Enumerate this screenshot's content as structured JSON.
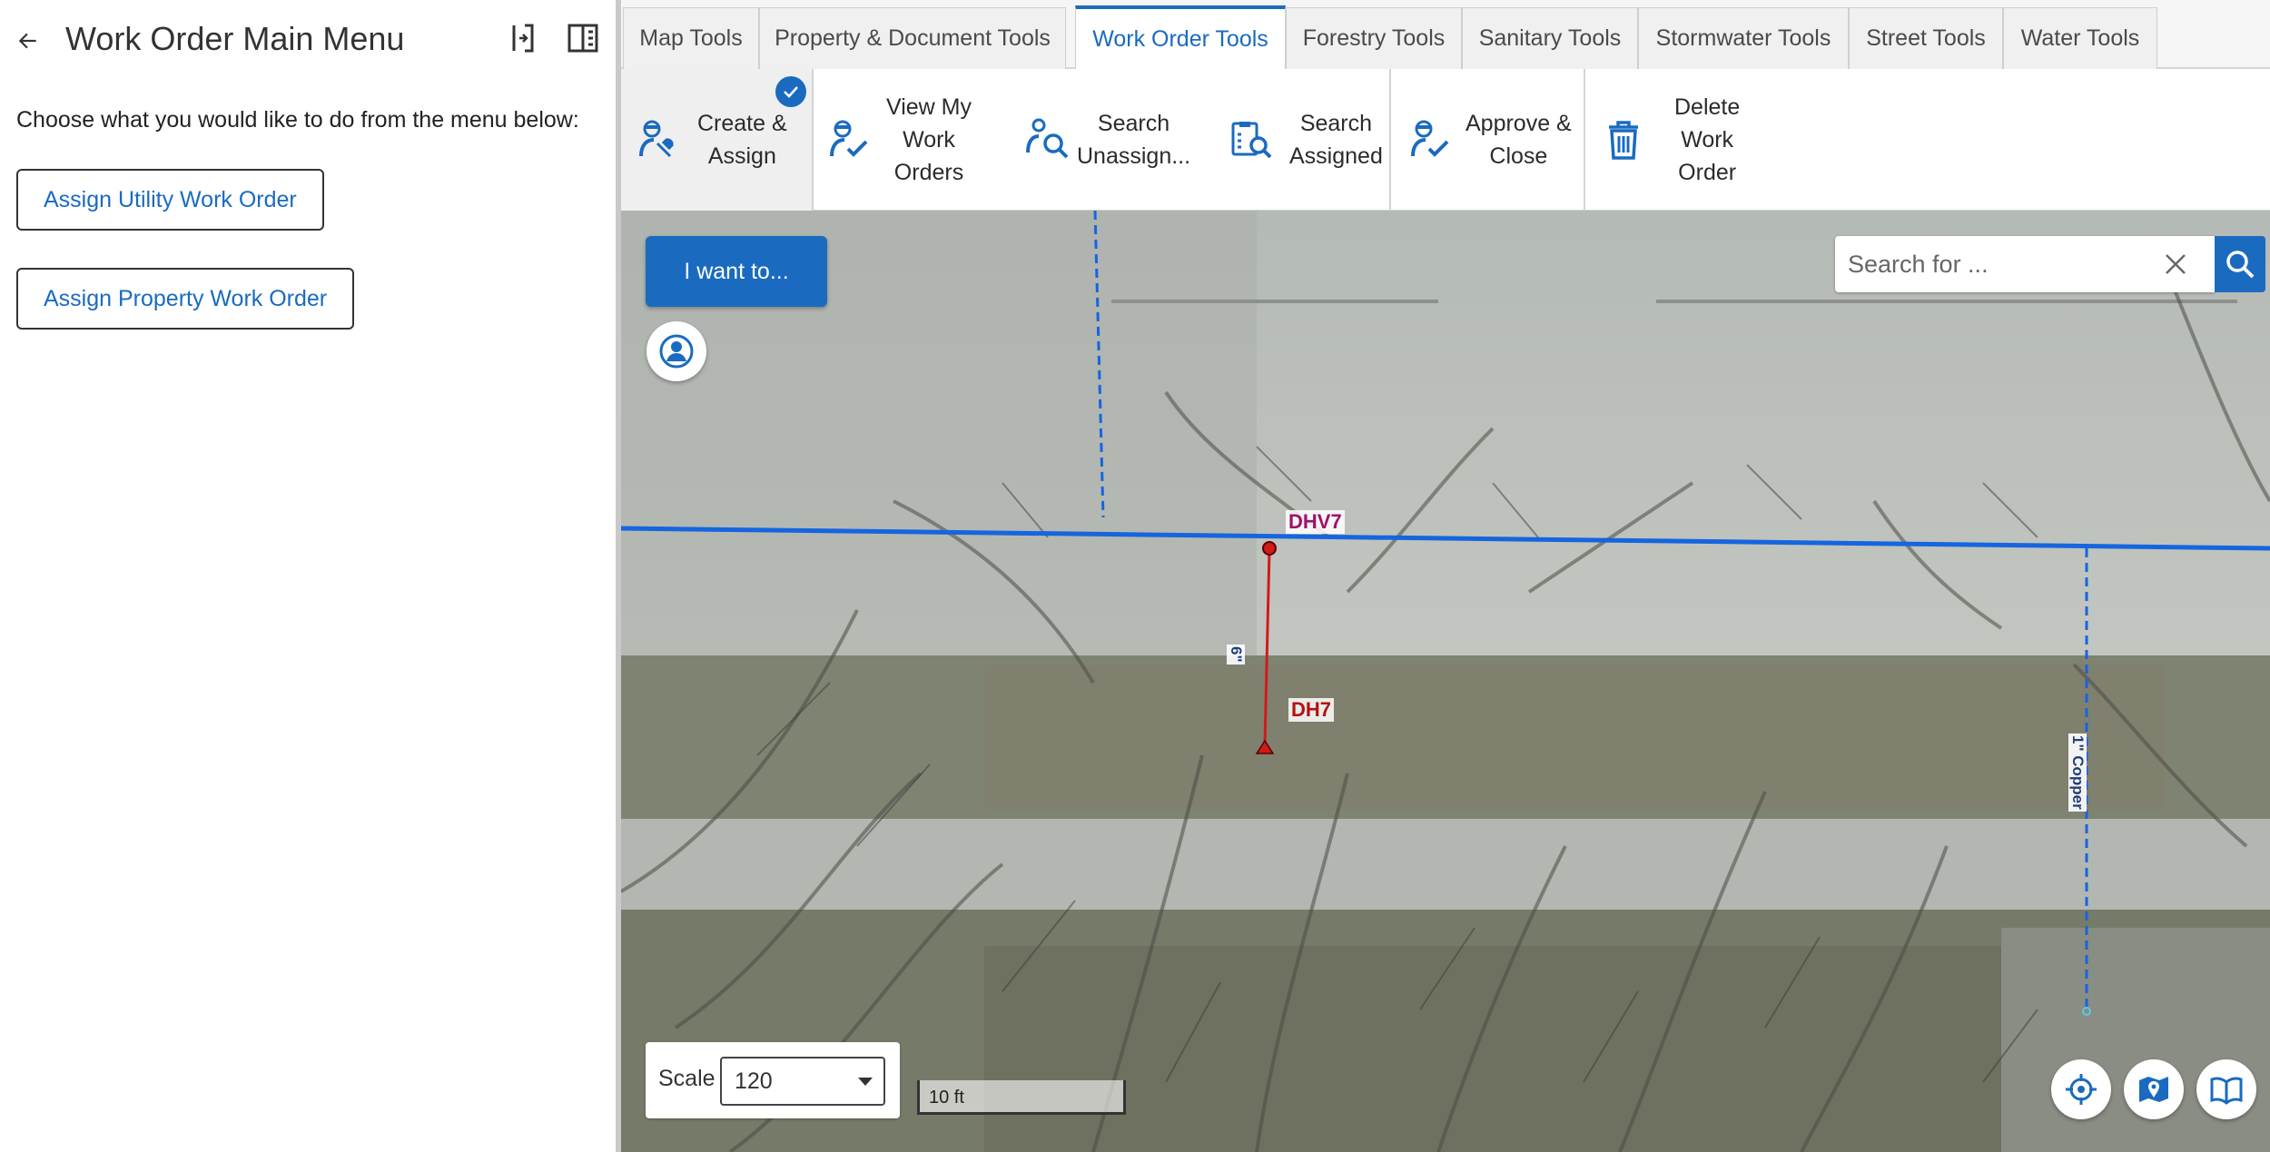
{
  "left_panel": {
    "title": "Work Order Main Menu",
    "instruction": "Choose what you would like to do from the menu below:",
    "buttons": [
      "Assign Utility Work Order",
      "Assign Property Work Order"
    ]
  },
  "tabs": [
    "Map Tools",
    "Property & Document Tools",
    "Work Order Tools",
    "Forestry Tools",
    "Sanitary Tools",
    "Stormwater Tools",
    "Street Tools",
    "Water Tools"
  ],
  "active_tab": "Work Order Tools",
  "ribbon": {
    "create_assign": "Create &\nAssign",
    "view_my": "View My\nWork\nOrders",
    "search_unassigned": "Search\nUnassign...",
    "search_assigned": "Search\nAssigned",
    "approve_close": "Approve &\nClose",
    "delete": "Delete\nWork\nOrder"
  },
  "map": {
    "i_want_to": "I want to...",
    "search_placeholder": "Search for ...",
    "scale_label": "Scale",
    "scale_value": "120",
    "scalebar_text": "10 ft",
    "feature_labels": {
      "valve": "DHV7",
      "hydrant": "DH7",
      "pipe_size": "6\"",
      "service_line": "1\" Copper"
    }
  },
  "colors": {
    "accent": "#1a6bbf",
    "water_main": "#1565e0",
    "hydrant_lead": "#d11a1a",
    "valve_label": "#a0106b"
  }
}
